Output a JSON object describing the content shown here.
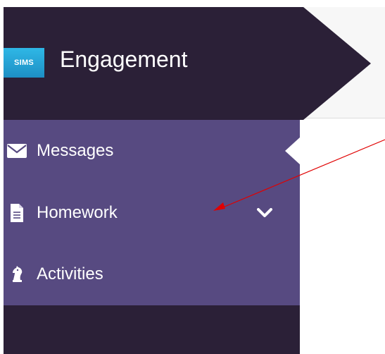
{
  "header": {
    "logo_text": "SIMS",
    "title": "Engagement"
  },
  "menu": {
    "items": [
      {
        "label": "Messages",
        "icon": "envelope-icon",
        "active": true
      },
      {
        "label": "Homework",
        "icon": "document-icon",
        "expandable": true,
        "chevron": "chevron-down-icon"
      },
      {
        "label": "Activities",
        "icon": "chess-knight-icon"
      }
    ]
  },
  "colors": {
    "header_dark": "#2b2037",
    "menu_purple": "#574a81",
    "logo_blue": "#2196cf",
    "annotation_red": "#e00000"
  }
}
